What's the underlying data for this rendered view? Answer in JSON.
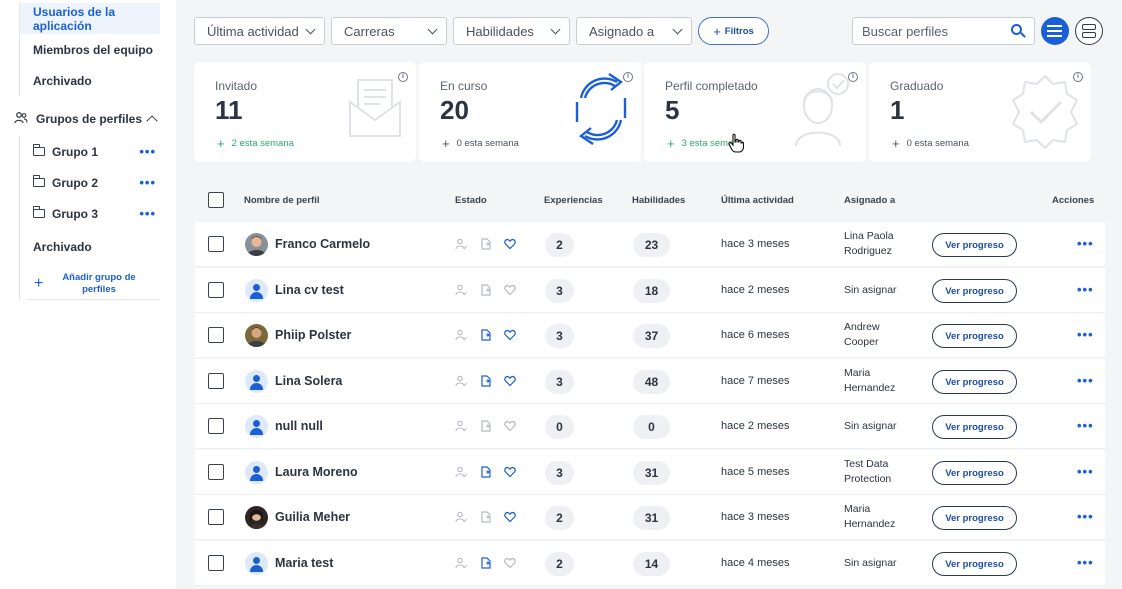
{
  "sidebar": {
    "top_items": [
      {
        "label": "Usuarios de la aplicación",
        "active": true
      },
      {
        "label": "Miembros del equipo",
        "active": false
      },
      {
        "label": "Archivado",
        "active": false
      }
    ],
    "groups_header": "Grupos de perfiles",
    "groups": [
      {
        "label": "Grupo 1",
        "menu": "•••"
      },
      {
        "label": "Grupo 2",
        "menu": "•••"
      },
      {
        "label": "Grupo 3",
        "menu": "•••"
      }
    ],
    "groups_archived": "Archivado",
    "add_group": "Añadir grupo de perfiles",
    "icons": {
      "groups": "people-icon",
      "folder": "folder-icon",
      "collapse": "chevron-up-icon",
      "add": "plus-icon"
    }
  },
  "toolbar": {
    "filters": [
      {
        "label": "Última actividad"
      },
      {
        "label": "Carreras"
      },
      {
        "label": "Habilidades"
      },
      {
        "label": "Asignado a"
      }
    ],
    "filtros_label": "Filtros",
    "search_placeholder": "Buscar perfiles",
    "accent": "#1a5fd6"
  },
  "cards": [
    {
      "title": "Invitado",
      "value": "11",
      "week": "2 esta semana",
      "week_color": "green",
      "icon": "envelope-icon"
    },
    {
      "title": "En curso",
      "value": "20",
      "week": "0 esta semana",
      "week_color": "grey",
      "icon": "refresh-icon"
    },
    {
      "title": "Perfil completado",
      "value": "5",
      "week": "3 esta semana",
      "week_color": "green",
      "icon": "person-check-icon"
    },
    {
      "title": "Graduado",
      "value": "1",
      "week": "0 esta semana",
      "week_color": "grey",
      "icon": "badge-check-icon"
    }
  ],
  "table": {
    "headers": {
      "name": "Nombre de perfil",
      "status": "Estado",
      "experiences": "Experiencias",
      "skills": "Habilidades",
      "last_activity": "Última actividad",
      "assigned": "Asignado a",
      "actions": "Acciones"
    },
    "progress_label": "Ver progreso",
    "actions_label": "•••",
    "rows": [
      {
        "name": "Franco Carmelo",
        "avatar": "photo",
        "doc_active": false,
        "heart_active": true,
        "experiences": "2",
        "skills": "23",
        "last": "hace 3 meses",
        "assigned": [
          "Lina Paola",
          "Rodriguez"
        ]
      },
      {
        "name": "Lina cv test",
        "avatar": "default",
        "doc_active": false,
        "heart_active": false,
        "experiences": "3",
        "skills": "18",
        "last": "hace 2 meses",
        "assigned": [
          "Sin asignar"
        ]
      },
      {
        "name": "Phiip Polster",
        "avatar": "photo",
        "doc_active": true,
        "heart_active": true,
        "experiences": "3",
        "skills": "37",
        "last": "hace 6 meses",
        "assigned": [
          "Andrew",
          "Cooper"
        ]
      },
      {
        "name": "Lina Solera",
        "avatar": "default",
        "doc_active": true,
        "heart_active": true,
        "experiences": "3",
        "skills": "48",
        "last": "hace 7 meses",
        "assigned": [
          "Maria",
          "Hernandez"
        ]
      },
      {
        "name": "null null",
        "avatar": "default",
        "doc_active": false,
        "heart_active": false,
        "experiences": "0",
        "skills": "0",
        "last": "hace 2 meses",
        "assigned": [
          "Sin asignar"
        ]
      },
      {
        "name": "Laura Moreno",
        "avatar": "default",
        "doc_active": true,
        "heart_active": true,
        "experiences": "3",
        "skills": "31",
        "last": "hace 5 meses",
        "assigned": [
          "Test Data",
          "Protection"
        ]
      },
      {
        "name": "Guilia Meher",
        "avatar": "photo-dark",
        "doc_active": false,
        "heart_active": true,
        "experiences": "2",
        "skills": "31",
        "last": "hace 3 meses",
        "assigned": [
          "Maria",
          "Hernandez"
        ]
      },
      {
        "name": "Maria test",
        "avatar": "default",
        "doc_active": true,
        "heart_active": false,
        "experiences": "2",
        "skills": "14",
        "last": "hace 4 meses",
        "assigned": [
          "Sin asignar"
        ]
      }
    ]
  }
}
